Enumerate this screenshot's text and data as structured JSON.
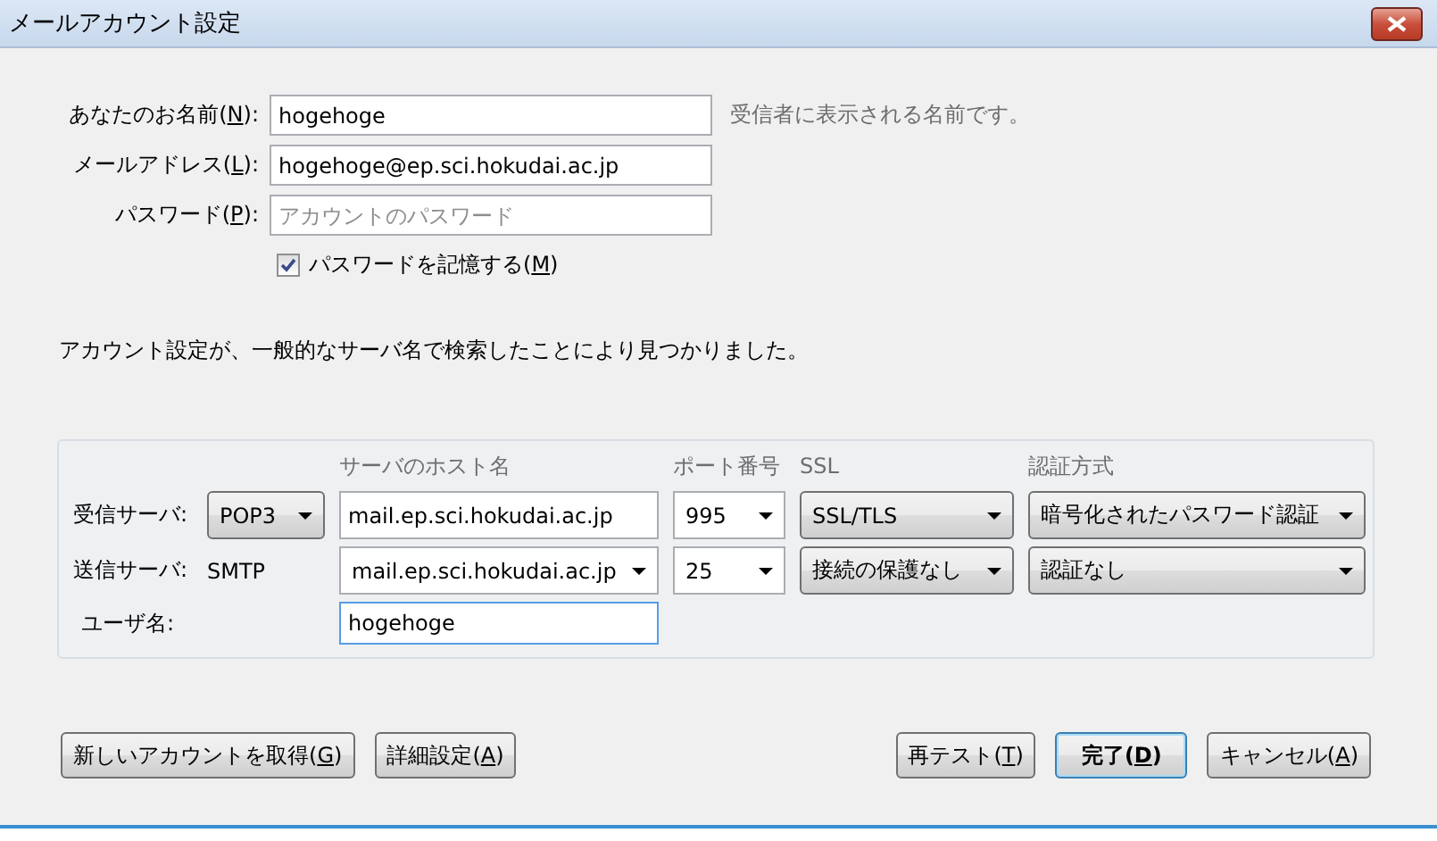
{
  "window": {
    "title": "メールアカウント設定"
  },
  "fields": [
    {
      "label": {
        "before": "あなたのお名前(",
        "access_key": "N",
        "after": "):"
      },
      "value": "hogehoge",
      "hint": "受信者に表示される名前です。"
    },
    {
      "label": {
        "before": "メールアドレス(",
        "access_key": "L",
        "after": "):"
      },
      "value": "hogehoge@ep.sci.hokudai.ac.jp"
    },
    {
      "label": {
        "before": "パスワード(",
        "access_key": "P",
        "after": "):"
      },
      "placeholder": "アカウントのパスワード"
    }
  ],
  "remember_password": {
    "label": {
      "before": "パスワードを記憶する(",
      "access_key": "M",
      "after": ")"
    },
    "checked": true
  },
  "message": "アカウント設定が、一般的なサーバ名で検索したことにより見つかりました。",
  "servers": {
    "columns": [
      "サーバのホスト名",
      "ポート番号",
      "SSL",
      "認証方式"
    ],
    "rows": [
      {
        "label": "受信サーバ:",
        "protocol": {
          "kind": "dropdown",
          "value": "POP3"
        },
        "host": {
          "kind": "input",
          "value": "mail.ep.sci.hokudai.ac.jp"
        },
        "port": "995",
        "ssl": "SSL/TLS",
        "auth": "暗号化されたパスワード認証"
      },
      {
        "label": "送信サーバ:",
        "protocol": {
          "kind": "text",
          "value": "SMTP"
        },
        "host": {
          "kind": "combo",
          "value": "mail.ep.sci.hokudai.ac.jp"
        },
        "port": "25",
        "ssl": "接続の保護なし",
        "auth": "認証なし"
      }
    ],
    "username": {
      "label": "ユーザ名:",
      "value": "hogehoge"
    }
  },
  "buttons_left": [
    {
      "label": {
        "before": "新しいアカウントを取得(",
        "access_key": "G",
        "after": ")"
      },
      "default": false
    },
    {
      "label": {
        "before": "詳細設定(",
        "access_key": "A",
        "after": ")"
      },
      "default": false
    }
  ],
  "buttons_right": [
    {
      "label": {
        "before": "再テスト(",
        "access_key": "T",
        "after": ")"
      },
      "default": false
    },
    {
      "label": {
        "before": "完了(",
        "access_key": "D",
        "after": ")"
      },
      "default": true
    },
    {
      "label": {
        "before": "キャンセル(",
        "access_key": "A",
        "after": ")"
      },
      "default": false
    }
  ]
}
